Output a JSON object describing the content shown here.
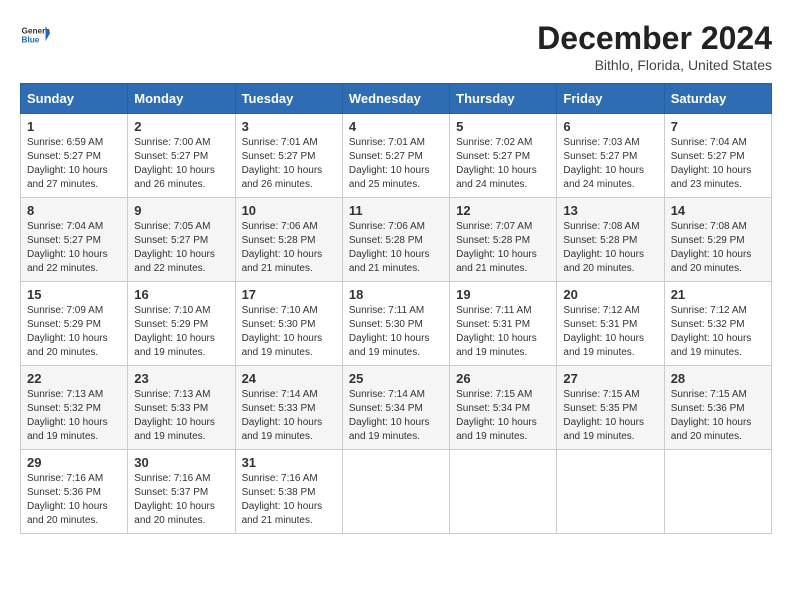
{
  "header": {
    "logo_general": "General",
    "logo_blue": "Blue",
    "month_title": "December 2024",
    "location": "Bithlo, Florida, United States"
  },
  "weekdays": [
    "Sunday",
    "Monday",
    "Tuesday",
    "Wednesday",
    "Thursday",
    "Friday",
    "Saturday"
  ],
  "weeks": [
    [
      {
        "day": 1,
        "sunrise": "6:59 AM",
        "sunset": "5:27 PM",
        "daylight": "10 hours and 27 minutes."
      },
      {
        "day": 2,
        "sunrise": "7:00 AM",
        "sunset": "5:27 PM",
        "daylight": "10 hours and 26 minutes."
      },
      {
        "day": 3,
        "sunrise": "7:01 AM",
        "sunset": "5:27 PM",
        "daylight": "10 hours and 26 minutes."
      },
      {
        "day": 4,
        "sunrise": "7:01 AM",
        "sunset": "5:27 PM",
        "daylight": "10 hours and 25 minutes."
      },
      {
        "day": 5,
        "sunrise": "7:02 AM",
        "sunset": "5:27 PM",
        "daylight": "10 hours and 24 minutes."
      },
      {
        "day": 6,
        "sunrise": "7:03 AM",
        "sunset": "5:27 PM",
        "daylight": "10 hours and 24 minutes."
      },
      {
        "day": 7,
        "sunrise": "7:04 AM",
        "sunset": "5:27 PM",
        "daylight": "10 hours and 23 minutes."
      }
    ],
    [
      {
        "day": 8,
        "sunrise": "7:04 AM",
        "sunset": "5:27 PM",
        "daylight": "10 hours and 22 minutes."
      },
      {
        "day": 9,
        "sunrise": "7:05 AM",
        "sunset": "5:27 PM",
        "daylight": "10 hours and 22 minutes."
      },
      {
        "day": 10,
        "sunrise": "7:06 AM",
        "sunset": "5:28 PM",
        "daylight": "10 hours and 21 minutes."
      },
      {
        "day": 11,
        "sunrise": "7:06 AM",
        "sunset": "5:28 PM",
        "daylight": "10 hours and 21 minutes."
      },
      {
        "day": 12,
        "sunrise": "7:07 AM",
        "sunset": "5:28 PM",
        "daylight": "10 hours and 21 minutes."
      },
      {
        "day": 13,
        "sunrise": "7:08 AM",
        "sunset": "5:28 PM",
        "daylight": "10 hours and 20 minutes."
      },
      {
        "day": 14,
        "sunrise": "7:08 AM",
        "sunset": "5:29 PM",
        "daylight": "10 hours and 20 minutes."
      }
    ],
    [
      {
        "day": 15,
        "sunrise": "7:09 AM",
        "sunset": "5:29 PM",
        "daylight": "10 hours and 20 minutes."
      },
      {
        "day": 16,
        "sunrise": "7:10 AM",
        "sunset": "5:29 PM",
        "daylight": "10 hours and 19 minutes."
      },
      {
        "day": 17,
        "sunrise": "7:10 AM",
        "sunset": "5:30 PM",
        "daylight": "10 hours and 19 minutes."
      },
      {
        "day": 18,
        "sunrise": "7:11 AM",
        "sunset": "5:30 PM",
        "daylight": "10 hours and 19 minutes."
      },
      {
        "day": 19,
        "sunrise": "7:11 AM",
        "sunset": "5:31 PM",
        "daylight": "10 hours and 19 minutes."
      },
      {
        "day": 20,
        "sunrise": "7:12 AM",
        "sunset": "5:31 PM",
        "daylight": "10 hours and 19 minutes."
      },
      {
        "day": 21,
        "sunrise": "7:12 AM",
        "sunset": "5:32 PM",
        "daylight": "10 hours and 19 minutes."
      }
    ],
    [
      {
        "day": 22,
        "sunrise": "7:13 AM",
        "sunset": "5:32 PM",
        "daylight": "10 hours and 19 minutes."
      },
      {
        "day": 23,
        "sunrise": "7:13 AM",
        "sunset": "5:33 PM",
        "daylight": "10 hours and 19 minutes."
      },
      {
        "day": 24,
        "sunrise": "7:14 AM",
        "sunset": "5:33 PM",
        "daylight": "10 hours and 19 minutes."
      },
      {
        "day": 25,
        "sunrise": "7:14 AM",
        "sunset": "5:34 PM",
        "daylight": "10 hours and 19 minutes."
      },
      {
        "day": 26,
        "sunrise": "7:15 AM",
        "sunset": "5:34 PM",
        "daylight": "10 hours and 19 minutes."
      },
      {
        "day": 27,
        "sunrise": "7:15 AM",
        "sunset": "5:35 PM",
        "daylight": "10 hours and 19 minutes."
      },
      {
        "day": 28,
        "sunrise": "7:15 AM",
        "sunset": "5:36 PM",
        "daylight": "10 hours and 20 minutes."
      }
    ],
    [
      {
        "day": 29,
        "sunrise": "7:16 AM",
        "sunset": "5:36 PM",
        "daylight": "10 hours and 20 minutes."
      },
      {
        "day": 30,
        "sunrise": "7:16 AM",
        "sunset": "5:37 PM",
        "daylight": "10 hours and 20 minutes."
      },
      {
        "day": 31,
        "sunrise": "7:16 AM",
        "sunset": "5:38 PM",
        "daylight": "10 hours and 21 minutes."
      },
      null,
      null,
      null,
      null
    ]
  ],
  "labels": {
    "sunrise": "Sunrise: ",
    "sunset": "Sunset: ",
    "daylight": "Daylight: "
  }
}
